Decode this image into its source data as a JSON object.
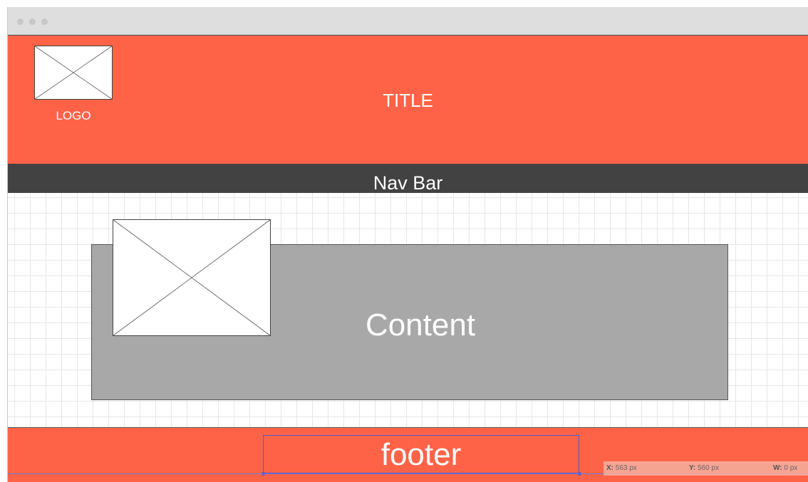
{
  "header": {
    "logo_label": "LOGO",
    "title": "TITLE"
  },
  "navbar": {
    "label": "Nav Bar"
  },
  "content": {
    "label": "Content"
  },
  "footer": {
    "label": "footer"
  },
  "position_readout": {
    "x_label": "X:",
    "x_value": "563 px",
    "y_label": "Y:",
    "y_value": "560 px",
    "w_label": "W:",
    "w_value": "0 px"
  },
  "colors": {
    "header_bg": "#ff6347",
    "navbar_bg": "#424242",
    "content_bg": "#a8a8a8",
    "footer_bg": "#ff6347",
    "selection": "#4a5bd6"
  },
  "icons": {
    "logo_placeholder": "image-placeholder-icon",
    "content_image": "image-placeholder-icon"
  }
}
